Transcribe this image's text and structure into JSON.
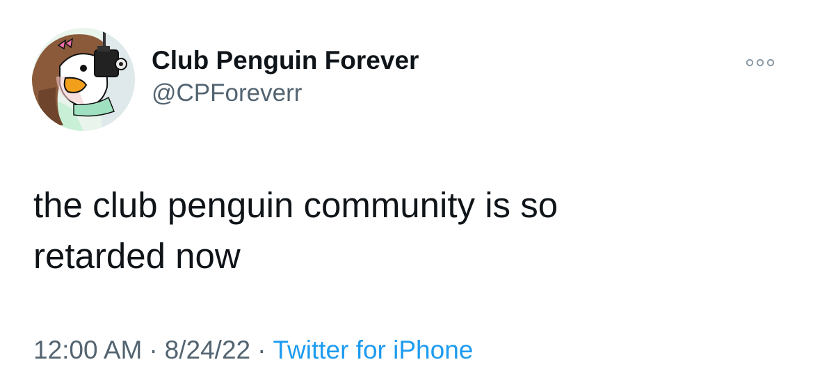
{
  "tweet": {
    "author": {
      "display_name": "Club Penguin Forever",
      "handle": "@CPForeverr",
      "avatar_icon": "penguin-with-camera-avatar"
    },
    "more_icon": "more-options-icon",
    "text_lines": [
      "the club penguin community is so",
      "retarded now"
    ],
    "meta": {
      "time": "12:00 AM",
      "separator": "·",
      "date": "8/24/22",
      "source": "Twitter for iPhone"
    }
  },
  "colors": {
    "text_primary": "#0f1419",
    "text_secondary": "#536471",
    "accent": "#1d9bf0",
    "more_dots": "#8899a6"
  }
}
